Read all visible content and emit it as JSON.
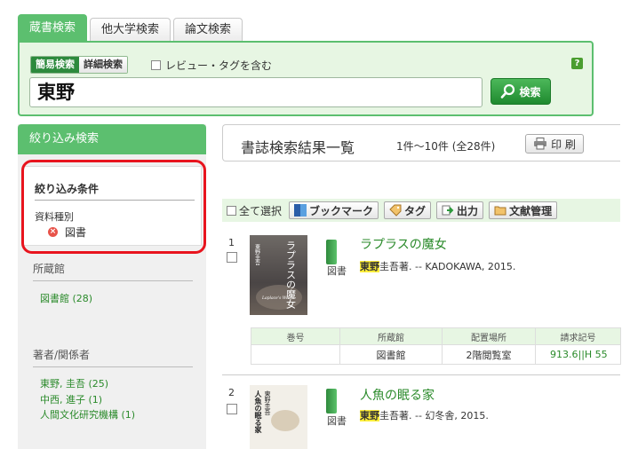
{
  "tabs": [
    {
      "label": "蔵書検索"
    },
    {
      "label": "他大学検索"
    },
    {
      "label": "論文検索"
    }
  ],
  "search": {
    "mode_simple": "簡易検索",
    "mode_advanced": "詳細検索",
    "review_tag_label": "レビュー・タグを含む",
    "help_label": "?",
    "query": "東野",
    "button_label": "検索"
  },
  "sidebar": {
    "header": "絞り込み検索",
    "conditions_title": "絞り込み条件",
    "material_type_label": "資料種別",
    "material_type_value": "図書",
    "holdings_title": "所蔵館",
    "holdings_items": [
      "図書館 (28)"
    ],
    "authors_title": "著者/関係者",
    "authors_items": [
      "東野, 圭吾 (25)",
      "中西, 進子 (1)",
      "人間文化研究機構 (1)"
    ]
  },
  "results": {
    "title": "書誌検索結果一覧",
    "count": "1件～10件 (全28件)",
    "print_label": "印 刷"
  },
  "toolbar": {
    "select_all": "全て選択",
    "bookmark": "ブックマーク",
    "tag": "タグ",
    "output": "出力",
    "reference": "文献管理"
  },
  "items": [
    {
      "num": "1",
      "title": "ラプラスの魔女",
      "type": "図書",
      "author_hl": "東野",
      "author_rest": "圭吾著. -- KADOKAWA, 2015.",
      "cover_text": "ラプラスの魔女",
      "cover_author": "東野圭吾",
      "cover_sub": "Laplace's Witch"
    },
    {
      "num": "2",
      "title": "人魚の眠る家",
      "type": "図書",
      "author_hl": "東野",
      "author_rest": "圭吾著. -- 幻冬舎, 2015.",
      "cover_text": "人魚の眠る家",
      "cover_author": "東野圭吾"
    }
  ],
  "holdings_table": {
    "headers": [
      "巻号",
      "所蔵館",
      "配置場所",
      "請求記号"
    ],
    "row": [
      "",
      "図書館",
      "2階閲覧室",
      "913.6||H 55"
    ]
  },
  "colors": {
    "accent": "#5cbf6f",
    "panel_bg": "#e7f6e3",
    "link": "#2a8a2a",
    "highlight": "#ffef3a",
    "outline": "#e8141e"
  }
}
